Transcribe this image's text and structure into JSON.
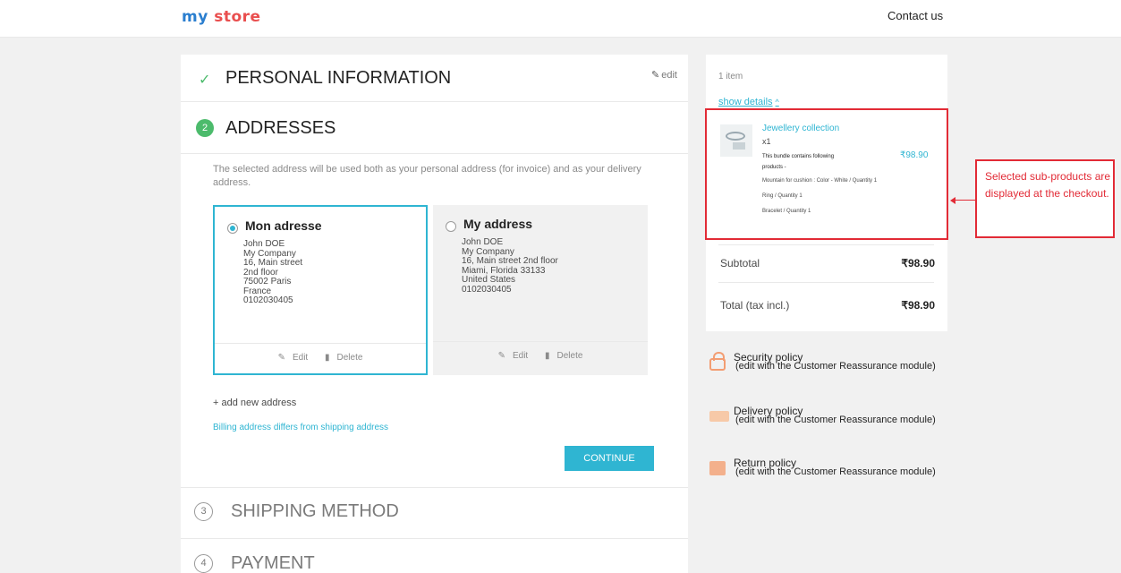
{
  "header": {
    "logo_part1": "my",
    "logo_part2": "store",
    "contact": "Contact us"
  },
  "steps": {
    "personal": {
      "title": "PERSONAL INFORMATION",
      "edit": "edit"
    },
    "addresses": {
      "number": "2",
      "title": "ADDRESSES"
    },
    "shipping": {
      "number": "3",
      "title": "SHIPPING METHOD"
    },
    "payment": {
      "number": "4",
      "title": "PAYMENT"
    }
  },
  "addresses": {
    "intro": "The selected address will be used both as your personal address (for invoice) and as your delivery address.",
    "cards": [
      {
        "alias": "Mon adresse",
        "lines": "John DOE\nMy Company\n16, Main street\n2nd floor\n75002 Paris\nFrance\n0102030405",
        "edit": "Edit",
        "delete": "Delete",
        "selected": true
      },
      {
        "alias": "My address",
        "lines": "John DOE\nMy Company\n16, Main street 2nd floor\nMiami, Florida 33133\nUnited States\n0102030405",
        "edit": "Edit",
        "delete": "Delete",
        "selected": false
      }
    ],
    "add_new": "+ add new address",
    "billing_link": "Billing address differs from shipping address",
    "continue": "CONTINUE"
  },
  "cart": {
    "item_count": "1 item",
    "show_details": "show details",
    "product": {
      "name": "Jewellery collection",
      "qty": "x1",
      "desc": "This bundle contains following products -",
      "price": "₹98.90",
      "sub_items": [
        "Mountain for cushion : Color - White / Quantity 1",
        "Ring / Quantity 1",
        "Bracelet / Quantity 1"
      ]
    },
    "subtotal_label": "Subtotal",
    "subtotal_value": "₹98.90",
    "total_label": "Total (tax incl.)",
    "total_value": "₹98.90"
  },
  "callout": {
    "text": "Selected sub-products are displayed at the checkout."
  },
  "reassurance": [
    {
      "title": "Security policy",
      "text": "(edit with the Customer Reassurance module)",
      "icon": "lock-icon"
    },
    {
      "title": "Delivery policy",
      "text": "(edit with the Customer Reassurance module)",
      "icon": "truck-icon"
    },
    {
      "title": "Return policy",
      "text": "(edit with the Customer Reassurance module)",
      "icon": "box-icon"
    }
  ],
  "colors": {
    "accent": "#2fb5d2",
    "success": "#4cbb6c",
    "annotation": "#e22b36"
  }
}
